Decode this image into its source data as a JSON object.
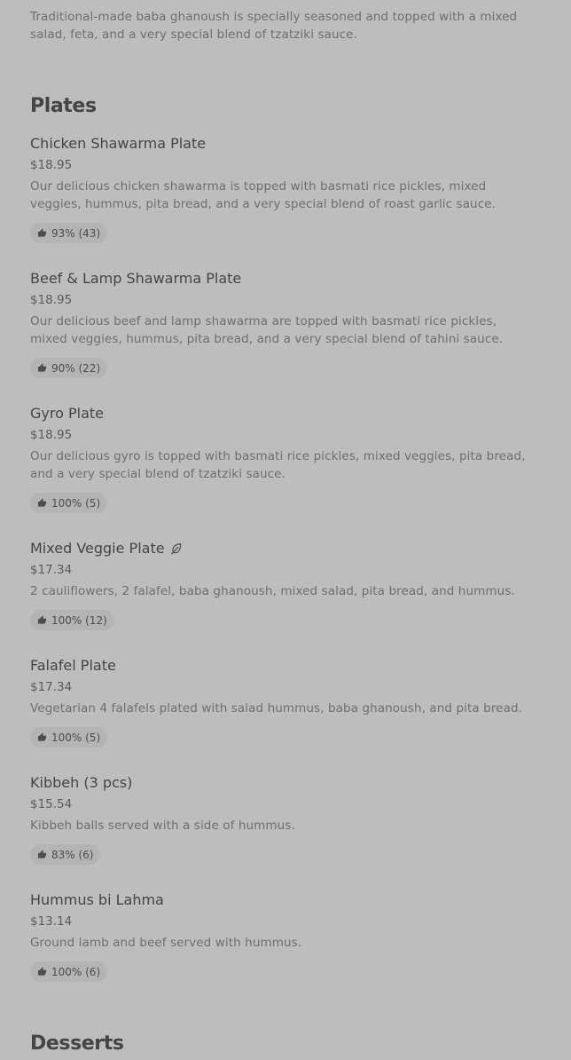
{
  "previous_item": {
    "description": "Traditional-made baba ghanoush is specially seasoned and topped with a mixed salad, feta, and a very special blend of tzatziki sauce."
  },
  "sections": {
    "plates": {
      "title": "Plates",
      "items": [
        {
          "name": "Chicken Shawarma Plate",
          "price": "$18.95",
          "description": "Our delicious chicken shawarma is topped with basmati rice pickles, mixed veggies, hummus, pita bread, and a very special blend of roast garlic sauce.",
          "rating": "93% (43)",
          "rating_icon": "thumbs-up-icon"
        },
        {
          "name": "Beef & Lamp Shawarma Plate",
          "price": "$18.95",
          "description": "Our delicious beef and lamp shawarma are topped with basmati rice pickles, mixed veggies, hummus, pita bread, and a very special blend of tahini sauce.",
          "rating": "90% (22)",
          "rating_icon": "thumbs-up-icon"
        },
        {
          "name": "Gyro Plate",
          "price": "$18.95",
          "description": "Our delicious gyro is topped with basmati rice pickles, mixed veggies, pita bread, and a very special blend of tzatziki sauce.",
          "rating": "100% (5)",
          "rating_icon": "thumbs-up-icon"
        },
        {
          "name": "Mixed Veggie Plate",
          "name_icon": "leaf-icon",
          "price": "$17.34",
          "description": "2 cauliflowers, 2 falafel, baba ghanoush, mixed salad, pita bread, and hummus.",
          "rating": "100% (12)",
          "rating_icon": "thumbs-up-icon"
        },
        {
          "name": "Falafel Plate",
          "price": "$17.34",
          "description": "Vegetarian 4 falafels plated with salad hummus, baba ghanoush, and pita bread.",
          "rating": "100% (5)",
          "rating_icon": "thumbs-up-icon"
        },
        {
          "name": "Kibbeh (3 pcs)",
          "price": "$15.54",
          "description": "Kibbeh balls served with a side of hummus.",
          "rating": "83% (6)",
          "rating_icon": "thumbs-up-icon"
        },
        {
          "name": "Hummus bi Lahma",
          "price": "$13.14",
          "description": "Ground lamb and beef served with hummus.",
          "rating": "100% (6)",
          "rating_icon": "thumbs-up-icon"
        }
      ]
    },
    "desserts": {
      "title": "Desserts"
    }
  },
  "colors": {
    "background": "#bdbdbd",
    "rating_pill": "#b4b4b4",
    "text_primary": "#454545",
    "text_secondary": "#6f6f6f"
  }
}
